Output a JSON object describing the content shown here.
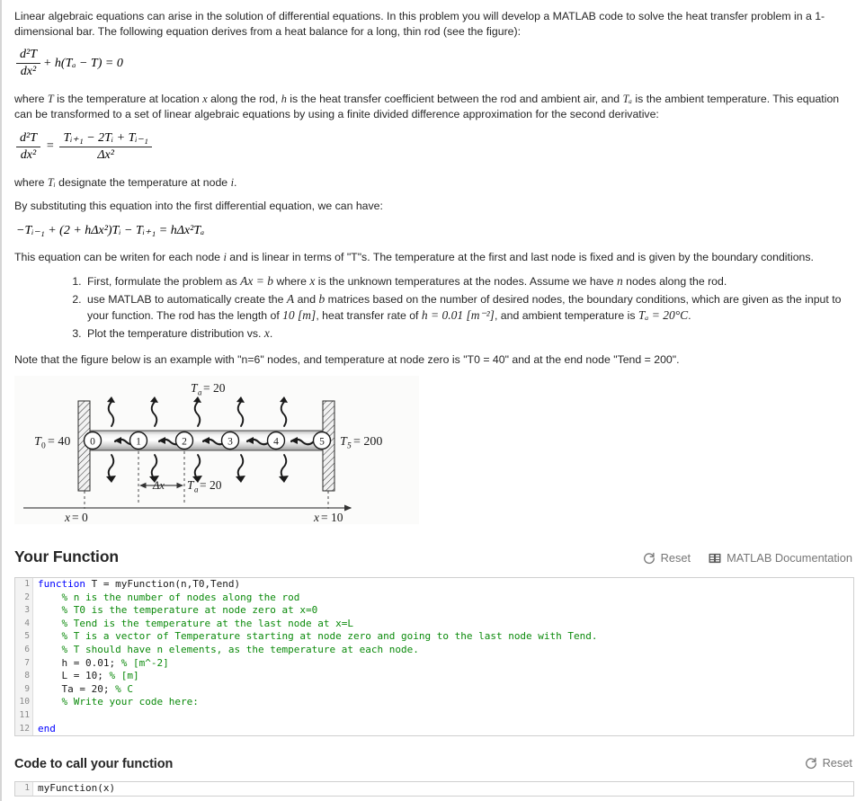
{
  "intro": {
    "p1": "Linear algebraic equations can arise in the solution of differential equations. In this problem you will develop a MATLAB code to solve the heat transfer problem in a 1-dimensional bar. The following equation derives from a heat balance for a long, thin rod (see the figure):",
    "eq1": {
      "num": "d²T",
      "den": "dx²",
      "rest": "+ h(Tₐ − T) = 0"
    },
    "p2_a": "where ",
    "p2_T": "T",
    "p2_b": " is the temperature at location ",
    "p2_x": "x",
    "p2_c": " along the rod, ",
    "p2_h": "h",
    "p2_d": " is the heat transfer coefficient between the rod and ambient air, and ",
    "p2_Ta": "Tₐ",
    "p2_e": " is the ambient temperature. This equation can be transformed to a set of linear algebraic equations by using a finite divided difference approximation for the second derivative:",
    "eq2": {
      "lhs_num": "d²T",
      "lhs_den": "dx²",
      "eq": "=",
      "rhs_num": "Tᵢ₊₁ − 2Tᵢ + Tᵢ₋₁",
      "rhs_den": "Δx²"
    },
    "p3_a": "where ",
    "p3_Ti": "Tᵢ",
    "p3_b": " designate the temperature at node ",
    "p3_i": "i",
    "p3_c": ".",
    "p4": "By substituting this equation into the first differential equation, we can have:",
    "eq3": "−Tᵢ₋₁ + (2 + hΔx²)Tᵢ − Tᵢ₊₁ = hΔx²Tₐ",
    "p5_a": "This equation can be writen for each node ",
    "p5_i": "i",
    "p5_b": " and is linear in terms of \"T\"s. The temperature at the first and last node is fixed and is given by the boundary conditions."
  },
  "steps": [
    {
      "parts": [
        {
          "t": "First, formulate the problem as ",
          "style": "plain"
        },
        {
          "t": "Ax = b",
          "style": "math"
        },
        {
          "t": " where ",
          "style": "plain"
        },
        {
          "t": "x",
          "style": "math"
        },
        {
          "t": " is the unknown temperatures at the nodes. Assume we have ",
          "style": "plain"
        },
        {
          "t": "n",
          "style": "math"
        },
        {
          "t": " nodes along the rod.",
          "style": "plain"
        }
      ]
    },
    {
      "parts": [
        {
          "t": "use MATLAB to automatically create the ",
          "style": "plain"
        },
        {
          "t": "A",
          "style": "math"
        },
        {
          "t": " and ",
          "style": "plain"
        },
        {
          "t": "b",
          "style": "math"
        },
        {
          "t": " matrices based on the number of desired nodes, the boundary conditions, which are given as the input to your function. The rod has the length of ",
          "style": "plain"
        },
        {
          "t": "10 [m]",
          "style": "math"
        },
        {
          "t": ", heat transfer rate of ",
          "style": "plain"
        },
        {
          "t": "h = 0.01 [m⁻²]",
          "style": "math"
        },
        {
          "t": ", and ambient temperature is ",
          "style": "plain"
        },
        {
          "t": "Tₐ = 20°C",
          "style": "math"
        },
        {
          "t": ".",
          "style": "plain"
        }
      ]
    },
    {
      "parts": [
        {
          "t": "Plot the temperature distribution vs. ",
          "style": "plain"
        },
        {
          "t": "x",
          "style": "math"
        },
        {
          "t": ".",
          "style": "plain"
        }
      ]
    }
  ],
  "note": "Note that the figure below is an example with \"n=6\" nodes, and temperature at node zero is \"T0 = 40\" and at the end node \"Tend = 200\".",
  "figure": {
    "label_top": "Tₐ = 20",
    "label_left": "T₀ = 40",
    "label_right": "T₅ = 200",
    "label_mid": "Tₐ = 20",
    "label_dx": "Δx",
    "label_x0": "x = 0",
    "label_xL": "x = 10",
    "nodes": [
      "0",
      "1",
      "2",
      "3",
      "4",
      "5"
    ]
  },
  "your_function": {
    "title": "Your Function",
    "reset_label": "Reset",
    "reset_icon": "refresh-icon",
    "docs_label": "MATLAB Documentation",
    "docs_icon": "book-icon",
    "code_lines": [
      {
        "n": "1",
        "segments": [
          {
            "t": "function",
            "c": "kw"
          },
          {
            "t": " T = myFunction(n,T0,Tend)",
            "c": ""
          }
        ]
      },
      {
        "n": "2",
        "segments": [
          {
            "t": "    ",
            "c": ""
          },
          {
            "t": "% n is the number of nodes along the rod",
            "c": "cm"
          }
        ]
      },
      {
        "n": "3",
        "segments": [
          {
            "t": "    ",
            "c": ""
          },
          {
            "t": "% T0 is the temperature at node zero at x=0",
            "c": "cm"
          }
        ]
      },
      {
        "n": "4",
        "segments": [
          {
            "t": "    ",
            "c": ""
          },
          {
            "t": "% Tend is the temperature at the last node at x=L",
            "c": "cm"
          }
        ]
      },
      {
        "n": "5",
        "segments": [
          {
            "t": "    ",
            "c": ""
          },
          {
            "t": "% T is a vector of Temperature starting at node zero and going to the last node with Tend.",
            "c": "cm"
          }
        ]
      },
      {
        "n": "6",
        "segments": [
          {
            "t": "    ",
            "c": ""
          },
          {
            "t": "% T should have n elements, as the temperature at each node.",
            "c": "cm"
          }
        ]
      },
      {
        "n": "7",
        "segments": [
          {
            "t": "    h = 0.01; ",
            "c": ""
          },
          {
            "t": "% [m^-2]",
            "c": "cm"
          }
        ]
      },
      {
        "n": "8",
        "segments": [
          {
            "t": "    L = 10; ",
            "c": ""
          },
          {
            "t": "% [m]",
            "c": "cm"
          }
        ]
      },
      {
        "n": "9",
        "segments": [
          {
            "t": "    Ta = 20; ",
            "c": ""
          },
          {
            "t": "% C",
            "c": "cm"
          }
        ]
      },
      {
        "n": "10",
        "segments": [
          {
            "t": "    ",
            "c": ""
          },
          {
            "t": "% Write your code here:",
            "c": "cm"
          }
        ]
      },
      {
        "n": "11",
        "segments": [
          {
            "t": "",
            "c": ""
          }
        ]
      },
      {
        "n": "12",
        "segments": [
          {
            "t": "end",
            "c": "kw"
          }
        ]
      }
    ]
  },
  "call_function": {
    "title": "Code to call your function",
    "reset_label": "Reset",
    "reset_icon": "refresh-icon",
    "code_lines": [
      {
        "n": "1",
        "segments": [
          {
            "t": "myFunction(x)",
            "c": ""
          }
        ]
      }
    ]
  },
  "colors": {
    "keyword": "#0000ff",
    "comment": "#0b8a0b",
    "tool_gray": "#767676",
    "text": "#262626"
  }
}
